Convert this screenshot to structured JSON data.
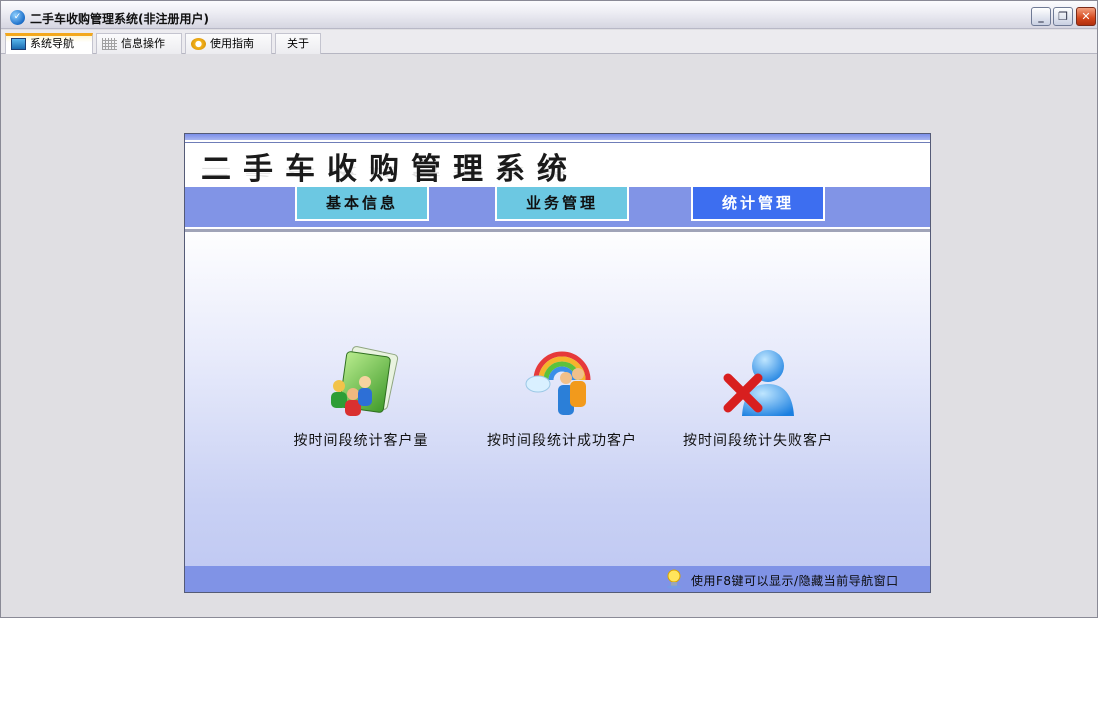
{
  "window": {
    "title": "二手车收购管理系统(非注册用户)",
    "minimize_label": "_",
    "maximize_label": "❐",
    "close_label": "✕"
  },
  "tabs": [
    {
      "label": "系统导航",
      "icon": "monitor-icon",
      "active": true
    },
    {
      "label": "信息操作",
      "icon": "grid-icon",
      "active": false
    },
    {
      "label": "使用指南",
      "icon": "help-icon",
      "active": false
    },
    {
      "label": "关于",
      "icon": "",
      "active": false
    }
  ],
  "panel": {
    "title": "二手车收购管理系统",
    "menu": [
      {
        "label": "基本信息",
        "active": false
      },
      {
        "label": "业务管理",
        "active": false
      },
      {
        "label": "统计管理",
        "active": true
      }
    ],
    "items": [
      {
        "label": "按时间段统计客户量",
        "icon": "customer-folder-icon"
      },
      {
        "label": "按时间段统计成功客户",
        "icon": "rainbow-user-icon"
      },
      {
        "label": "按时间段统计失败客户",
        "icon": "user-delete-icon"
      }
    ],
    "status_text": "使用F8键可以显示/隐藏当前导航窗口"
  },
  "colors": {
    "menubar": "#8194e6",
    "menu_button": "#6cc8e2",
    "menu_button_active": "#3d6ef0",
    "tab_active_accent": "#f3a81c"
  }
}
